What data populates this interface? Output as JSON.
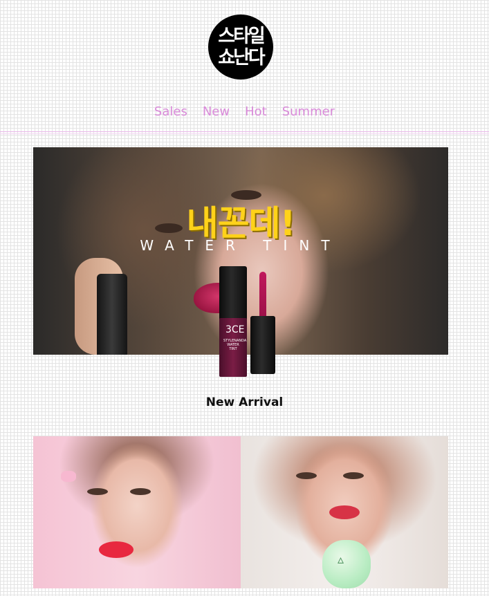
{
  "logo": {
    "line1": "스타일",
    "line2": "쇼난다"
  },
  "nav": [
    "Sales",
    "New",
    "Hot",
    "Summer"
  ],
  "hero": {
    "title": "내꼰데!",
    "subtitle": "WATER TINT",
    "bottle_brand": "3CE",
    "bottle_label": "STYLENANDA WATER TINT"
  },
  "section": {
    "title": "New Arrival"
  },
  "colors": {
    "nav": "#d98ad9",
    "hero_title": "#ffd21a",
    "divider": "#e9b6e9"
  }
}
